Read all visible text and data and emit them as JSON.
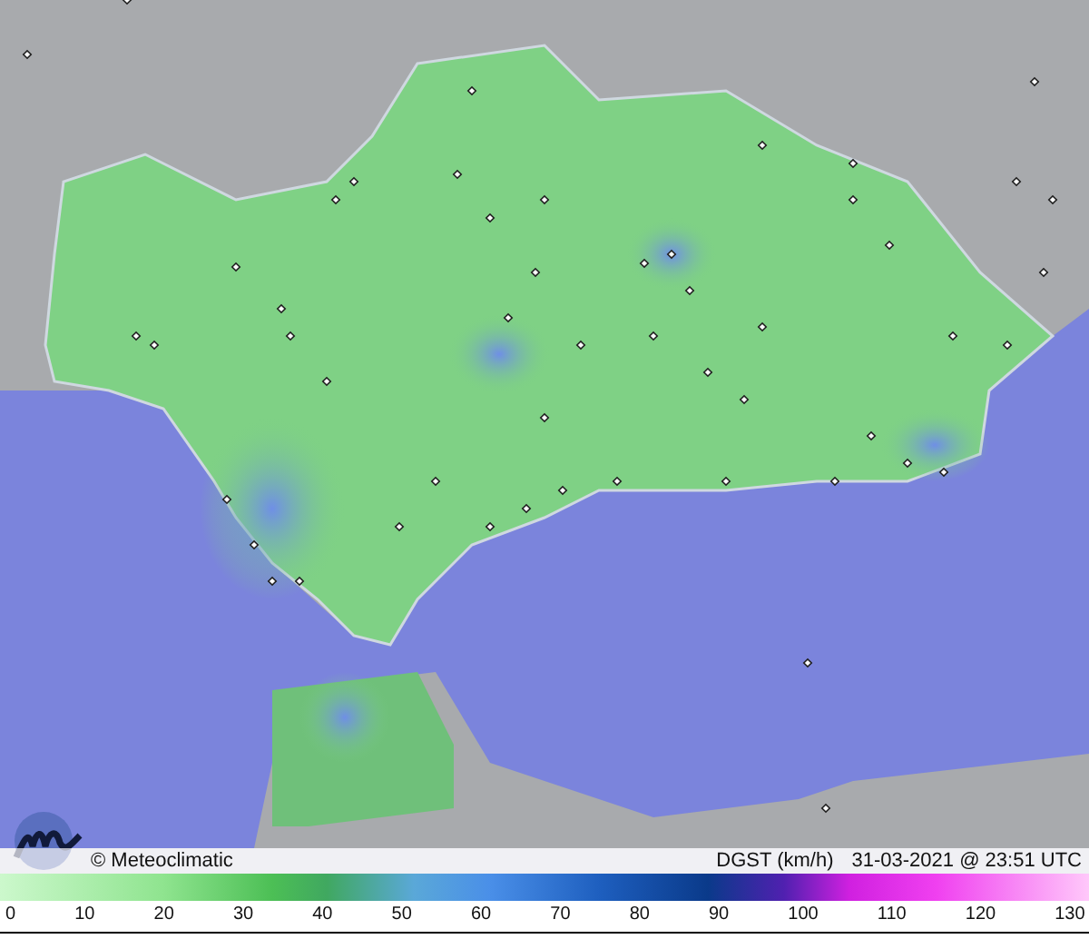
{
  "map": {
    "credit": "© Meteoclimatic",
    "variable": "DGST (km/h)",
    "timestamp": "31-03-2021 @ 23:51 UTC"
  },
  "legend": {
    "labels": [
      "0",
      "10",
      "20",
      "30",
      "40",
      "50",
      "60",
      "70",
      "80",
      "90",
      "100",
      "110",
      "120",
      "130"
    ]
  }
}
